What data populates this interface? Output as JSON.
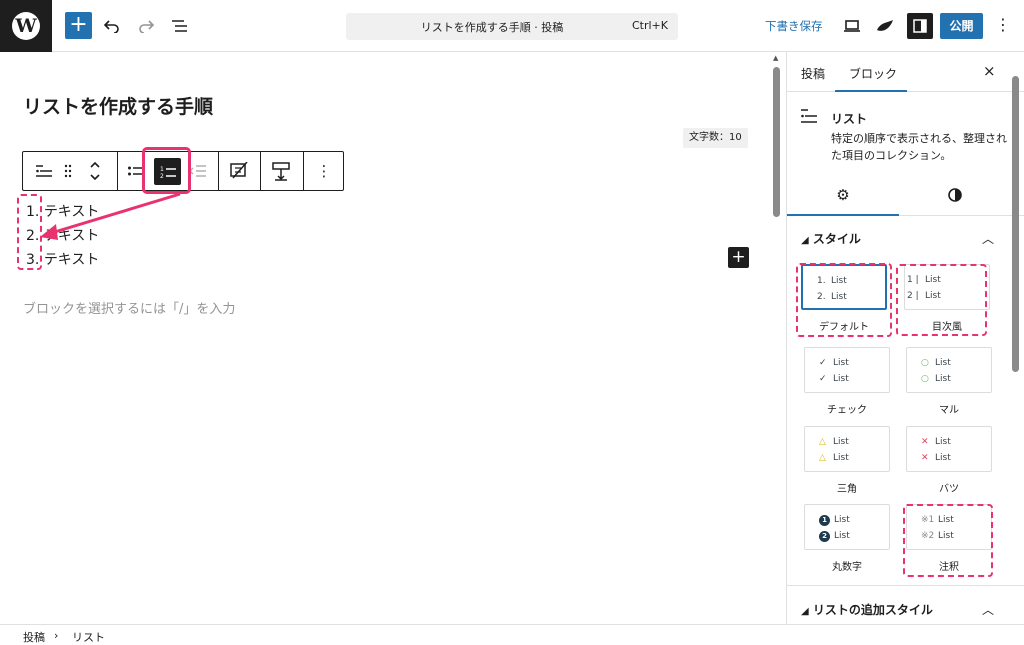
{
  "topbar": {
    "document_title": "リストを作成する手順 · 投稿",
    "shortcut": "Ctrl+K",
    "save_draft": "下書き保存",
    "publish": "公開",
    "add_symbol": "+",
    "logo_letter": "W"
  },
  "editor": {
    "post_title": "リストを作成する手順",
    "word_count": "文字数：10",
    "list_items": [
      {
        "num": "1.",
        "text": "テキスト"
      },
      {
        "num": "2.",
        "text": "テキスト"
      },
      {
        "num": "3.",
        "text": "テキスト"
      }
    ],
    "placeholder": "ブロックを選択するには「/」を入力"
  },
  "sidebar": {
    "tabs": [
      "投稿",
      "ブロック"
    ],
    "close_symbol": "×",
    "block": {
      "name": "リスト",
      "description": "特定の順序で表示される、整理された項目のコレクション。"
    },
    "style_panel_title": "スタイル",
    "styles": [
      {
        "label": "デフォルト",
        "markers": [
          "1.",
          "2."
        ],
        "item": "List"
      },
      {
        "label": "目次風",
        "markers": [
          "1 |",
          "2 |"
        ],
        "item": "List"
      },
      {
        "label": "チェック",
        "markers": [
          "✓",
          "✓"
        ],
        "item": "List"
      },
      {
        "label": "マル",
        "markers": [
          "○",
          "○"
        ],
        "item": "List"
      },
      {
        "label": "三角",
        "markers": [
          "△",
          "△"
        ],
        "item": "List"
      },
      {
        "label": "バツ",
        "markers": [
          "✕",
          "✕"
        ],
        "item": "List"
      },
      {
        "label": "丸数字",
        "markers": [
          "1",
          "2"
        ],
        "item": "List"
      },
      {
        "label": "注釈",
        "markers": [
          "※1",
          "※2"
        ],
        "item": "List"
      }
    ],
    "extra_panel_title": "リストの追加スタイル"
  },
  "breadcrumb": [
    "投稿",
    "リスト"
  ],
  "colors": {
    "accent": "#2271b1",
    "annotation": "#e8336e",
    "dark": "#1e1e1e"
  }
}
